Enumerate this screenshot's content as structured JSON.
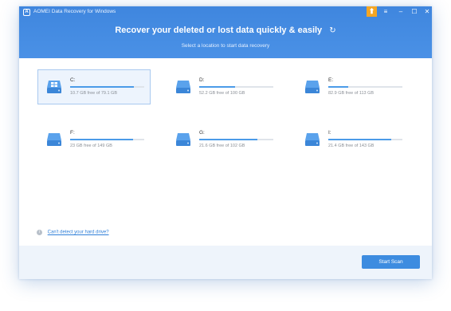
{
  "window": {
    "title": "AOMEI Data Recovery for Windows"
  },
  "header": {
    "headline": "Recover your deleted or lost data quickly & easily",
    "subline": "Select a location to start data recovery"
  },
  "drives": [
    {
      "letter": "C:",
      "free": "10.7 GB free of 79.1 GB",
      "used_fraction": 0.86,
      "selected": true
    },
    {
      "letter": "D:",
      "free": "52.2 GB free of 100 GB",
      "used_fraction": 0.48,
      "selected": false
    },
    {
      "letter": "E:",
      "free": "82.9 GB free of 113 GB",
      "used_fraction": 0.27,
      "selected": false
    },
    {
      "letter": "F:",
      "free": "23 GB free of 149 GB",
      "used_fraction": 0.85,
      "selected": false
    },
    {
      "letter": "G:",
      "free": "21.6 GB free of 102 GB",
      "used_fraction": 0.79,
      "selected": false
    },
    {
      "letter": "I:",
      "free": "21.4 GB free of 143 GB",
      "used_fraction": 0.85,
      "selected": false
    }
  ],
  "help": {
    "link": "Can't detect your hard drive?"
  },
  "footer": {
    "start_label": "Start Scan"
  },
  "colors": {
    "header": "#4a91e6",
    "accent": "#3d8ce0",
    "upgrade": "#f5a623"
  }
}
